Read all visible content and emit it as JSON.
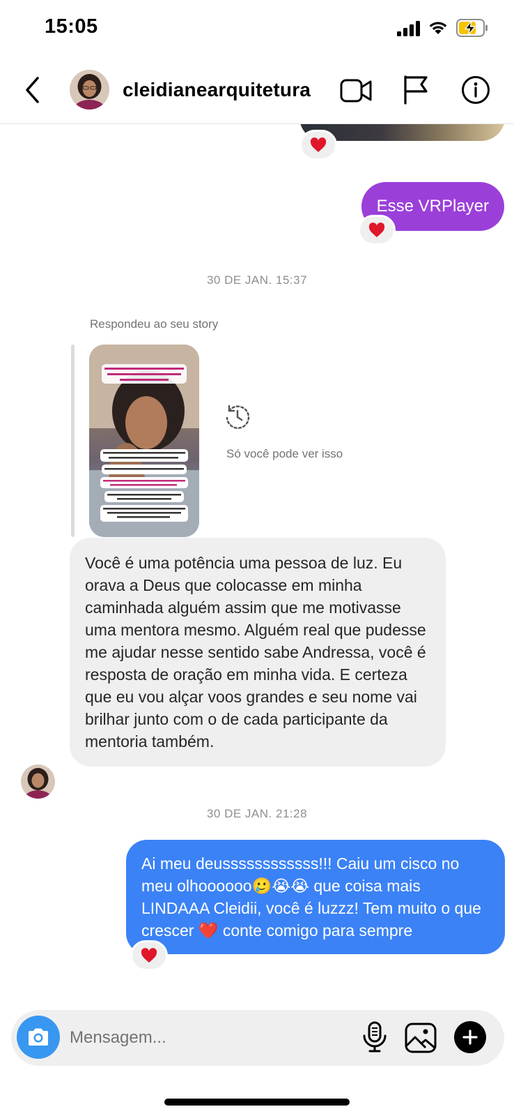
{
  "status_bar": {
    "time": "15:05"
  },
  "header": {
    "username": "cleidianearquitetura"
  },
  "messages": {
    "out_purple": "Esse VRPlayer",
    "timestamp_1": "30 DE JAN. 15:37",
    "story_caption": "Respondeu ao seu story",
    "story_note": "Só você pode ver isso",
    "incoming_text": "Você é uma potência uma pessoa de luz. Eu orava a Deus que colocasse em minha caminhada alguém assim que me motivasse uma mentora mesmo. Alguém real que pudesse me ajudar nesse sentido sabe Andressa, você é resposta de oração em minha vida. E certeza que eu vou alçar voos grandes e seu nome vai brilhar junto com o de cada participante da mentoria também.",
    "timestamp_2": "30 DE JAN. 21:28",
    "outgoing_blue": "Ai meu deussssssssssss!!! Caiu um cisco no meu olhoooooo🥲😭😭 que coisa mais LINDAAA Cleidii, você é luzzz! Tem muito o que crescer ❤️ conte comigo para sempre"
  },
  "reactions": {
    "heart": "❤️"
  },
  "composer": {
    "placeholder": "Mensagem..."
  },
  "colors": {
    "purple_bubble": "#9b3fd9",
    "blue_bubble": "#3b82f6",
    "camera_button": "#3897f0",
    "incoming_bubble": "#efefef"
  }
}
